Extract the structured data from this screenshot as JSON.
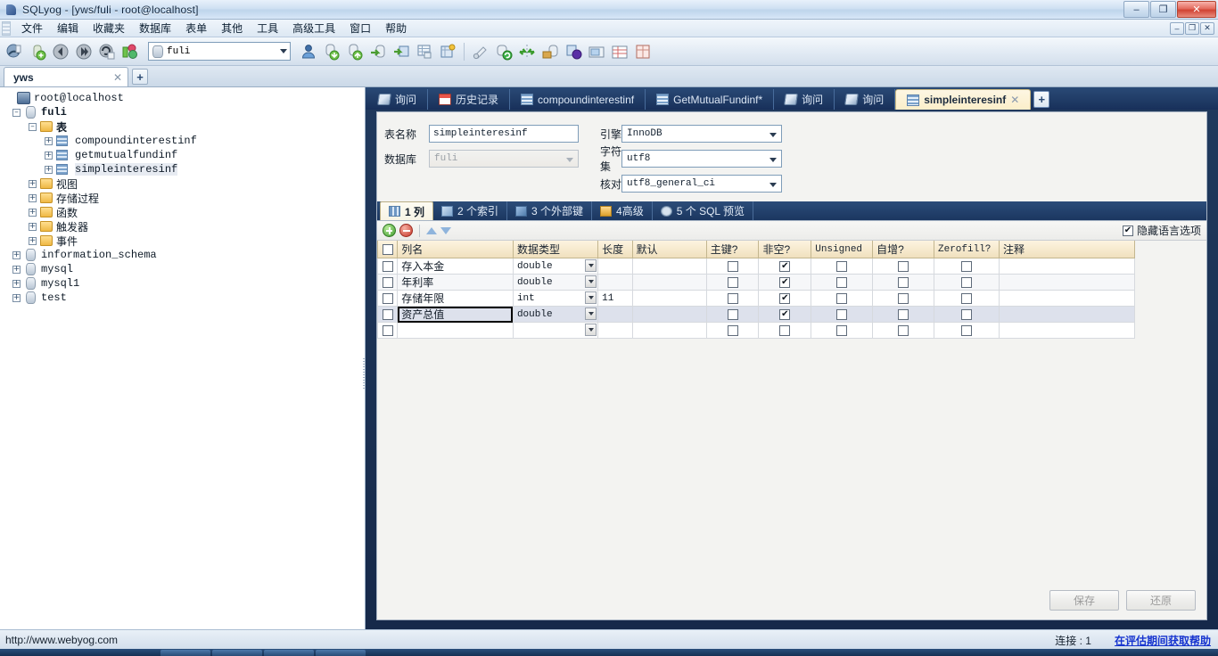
{
  "window": {
    "title": "SQLyog - [yws/fuli - root@localhost]",
    "minimize": "–",
    "maximize": "❐",
    "close": "✕",
    "inner_minimize": "–",
    "inner_restore": "❐",
    "inner_close": "✕"
  },
  "menubar": {
    "items": [
      {
        "label": "文件"
      },
      {
        "label": "编辑"
      },
      {
        "label": "收藏夹"
      },
      {
        "label": "数据库"
      },
      {
        "label": "表单"
      },
      {
        "label": "其他"
      },
      {
        "label": "工具"
      },
      {
        "label": "高级工具"
      },
      {
        "label": "窗口"
      },
      {
        "label": "帮助"
      }
    ]
  },
  "toolbar": {
    "db_selector_value": "fuli",
    "icons": [
      "connect-icon",
      "new-connection-icon",
      "back-icon",
      "forward-icon",
      "refresh-icon",
      "color-tools-icon"
    ],
    "icons_right": [
      "user-manager-icon",
      "import-icon",
      "export-icon",
      "restore-icon",
      "backup-table-icon",
      "table-data-icon",
      "schema-key-icon",
      "query-builder-icon",
      "sync-icon",
      "compare-icon",
      "migrate-icon",
      "notifications-icon",
      "scheduler-icon",
      "grid-view-icon",
      "form-view-icon"
    ]
  },
  "connection_tabs": {
    "tabs": [
      {
        "label": "yws",
        "close": "✕"
      }
    ],
    "new_tab": "+"
  },
  "tree": {
    "nodes": [
      {
        "label": "root@localhost",
        "icon": "server-icon",
        "indent": 0,
        "expander": "",
        "bold": false,
        "mono": true
      },
      {
        "label": "fuli",
        "icon": "database-icon",
        "indent": 1,
        "expander": "–",
        "bold": true,
        "mono": true
      },
      {
        "label": "表",
        "icon": "folder-icon",
        "indent": 2,
        "expander": "–",
        "bold": false,
        "mono": false
      },
      {
        "label": "compoundinterestinf",
        "icon": "table-icon",
        "indent": 3,
        "expander": "+",
        "bold": false,
        "mono": true
      },
      {
        "label": "getmutualfundinf",
        "icon": "table-icon",
        "indent": 3,
        "expander": "+",
        "bold": false,
        "mono": true
      },
      {
        "label": "simpleinteresinf",
        "icon": "table-icon",
        "indent": 3,
        "expander": "+",
        "bold": false,
        "mono": true,
        "selected": true
      },
      {
        "label": "视图",
        "icon": "folder-icon",
        "indent": 2,
        "expander": "+",
        "bold": false,
        "mono": false
      },
      {
        "label": "存储过程",
        "icon": "folder-icon",
        "indent": 2,
        "expander": "+",
        "bold": false,
        "mono": false
      },
      {
        "label": "函数",
        "icon": "folder-icon",
        "indent": 2,
        "expander": "+",
        "bold": false,
        "mono": false
      },
      {
        "label": "触发器",
        "icon": "folder-icon",
        "indent": 2,
        "expander": "+",
        "bold": false,
        "mono": false
      },
      {
        "label": "事件",
        "icon": "folder-icon",
        "indent": 2,
        "expander": "+",
        "bold": false,
        "mono": false
      },
      {
        "label": "information_schema",
        "icon": "database-icon",
        "indent": 1,
        "expander": "+",
        "bold": false,
        "mono": true
      },
      {
        "label": "mysql",
        "icon": "database-icon",
        "indent": 1,
        "expander": "+",
        "bold": false,
        "mono": true
      },
      {
        "label": "mysql1",
        "icon": "database-icon",
        "indent": 1,
        "expander": "+",
        "bold": false,
        "mono": true
      },
      {
        "label": "test",
        "icon": "database-icon",
        "indent": 1,
        "expander": "+",
        "bold": false,
        "mono": true
      }
    ]
  },
  "editor_tabs": {
    "tabs": [
      {
        "label": "询问",
        "icon": "query-icon",
        "active": false
      },
      {
        "label": "历史记录",
        "icon": "history-icon",
        "active": false
      },
      {
        "label": "compoundinterestinf",
        "icon": "table-icon",
        "active": false
      },
      {
        "label": "GetMutualFundinf*",
        "icon": "table-icon",
        "active": false
      },
      {
        "label": "询问",
        "icon": "query-icon",
        "active": false
      },
      {
        "label": "询问",
        "icon": "query-icon",
        "active": false
      },
      {
        "label": "simpleinteresinf",
        "icon": "table-icon",
        "active": true,
        "close": "✕"
      }
    ],
    "new_tab": "+"
  },
  "form": {
    "table_name_label": "表名称",
    "table_name_value": "simpleinteresinf",
    "database_label": "数据库",
    "database_value": "fuli",
    "engine_label": "引擎",
    "engine_value": "InnoDB",
    "charset_label": "字符集",
    "charset_value": "utf8",
    "collation_label": "核对",
    "collation_value": "utf8_general_ci"
  },
  "inner_tabs": {
    "tabs": [
      {
        "label": "1 列",
        "icon": "columns-icon",
        "active": true
      },
      {
        "label": "2 个索引",
        "icon": "index-icon",
        "active": false
      },
      {
        "label": "3 个外部键",
        "icon": "foreign-key-icon",
        "active": false
      },
      {
        "label": "4高级",
        "icon": "advanced-icon",
        "active": false
      },
      {
        "label": "5 个 SQL 预览",
        "icon": "sql-preview-icon",
        "active": false
      }
    ]
  },
  "grid_toolbar": {
    "add_icon": "add-row-icon",
    "delete_icon": "delete-row-icon",
    "move_up_icon": "move-up-icon",
    "move_down_icon": "move-down-icon",
    "hide_language_label": "隐藏语言选项",
    "hide_language_checked": "✔"
  },
  "grid": {
    "headers": [
      {
        "label": "",
        "key": "check"
      },
      {
        "label": "列名",
        "key": "name"
      },
      {
        "label": "数据类型",
        "key": "datatype"
      },
      {
        "label": "长度",
        "key": "length"
      },
      {
        "label": "默认",
        "key": "default"
      },
      {
        "label": "主键?",
        "key": "pk"
      },
      {
        "label": "非空?",
        "key": "notnull"
      },
      {
        "label": "Unsigned",
        "key": "unsigned"
      },
      {
        "label": "自增?",
        "key": "autoinc"
      },
      {
        "label": "Zerofill?",
        "key": "zerofill"
      },
      {
        "label": "注释",
        "key": "comment"
      }
    ],
    "rows": [
      {
        "check": "",
        "name": "存入本金",
        "datatype": "double",
        "length": "",
        "default": "",
        "pk": "",
        "notnull": "✔",
        "unsigned": "",
        "autoinc": "",
        "zerofill": "",
        "comment": "",
        "selected": false,
        "editing": false
      },
      {
        "check": "",
        "name": "年利率",
        "datatype": "double",
        "length": "",
        "default": "",
        "pk": "",
        "notnull": "✔",
        "unsigned": "",
        "autoinc": "",
        "zerofill": "",
        "comment": "",
        "selected": false,
        "editing": false
      },
      {
        "check": "",
        "name": "存储年限",
        "datatype": "int",
        "length": "11",
        "default": "",
        "pk": "",
        "notnull": "✔",
        "unsigned": "",
        "autoinc": "",
        "zerofill": "",
        "comment": "",
        "selected": false,
        "editing": false
      },
      {
        "check": "",
        "name": "资产总值",
        "datatype": "double",
        "length": "",
        "default": "",
        "pk": "",
        "notnull": "✔",
        "unsigned": "",
        "autoinc": "",
        "zerofill": "",
        "comment": "",
        "selected": true,
        "editing": true
      },
      {
        "check": "",
        "name": "",
        "datatype": "",
        "length": "",
        "default": "",
        "pk": "",
        "notnull": "",
        "unsigned": "",
        "autoinc": "",
        "zerofill": "",
        "comment": "",
        "selected": false,
        "editing": false
      }
    ]
  },
  "footer": {
    "save_label": "保存",
    "revert_label": "还原"
  },
  "statusbar": {
    "url": "http://www.webyog.com",
    "connections": "连接 : 1",
    "help_link": "在评估期间获取帮助"
  }
}
